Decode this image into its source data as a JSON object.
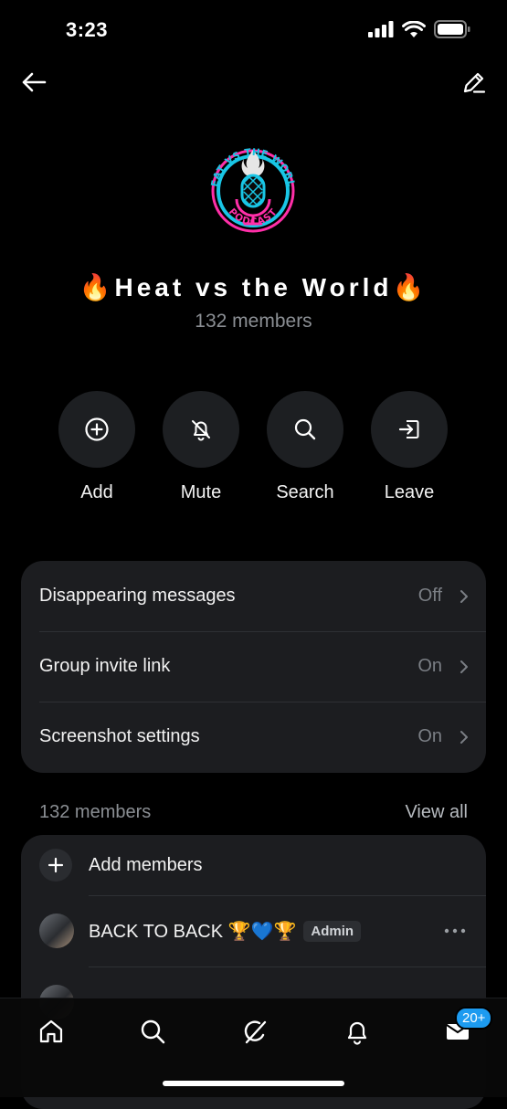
{
  "status": {
    "time": "3:23"
  },
  "group": {
    "name": "🔥Heat vs the World🔥",
    "member_count": "132 members",
    "logo_text_top": "HEAT VS THE WORLD",
    "logo_text_bottom": "PODCAST"
  },
  "actions": [
    {
      "label": "Add",
      "icon": "add-circle-icon"
    },
    {
      "label": "Mute",
      "icon": "bell-off-icon"
    },
    {
      "label": "Search",
      "icon": "search-icon"
    },
    {
      "label": "Leave",
      "icon": "leave-icon"
    }
  ],
  "settings": [
    {
      "title": "Disappearing messages",
      "value": "Off"
    },
    {
      "title": "Group invite link",
      "value": "On"
    },
    {
      "title": "Screenshot settings",
      "value": "On"
    }
  ],
  "members_section": {
    "header": "132 members",
    "view_all": "View all",
    "add_label": "Add members",
    "members": [
      {
        "name": "BACK TO BACK 🏆💙🏆",
        "badge": "Admin"
      }
    ]
  },
  "tabbar": {
    "items": [
      "home-icon",
      "search-icon",
      "grok-icon",
      "bell-icon",
      "mail-icon"
    ],
    "mail_badge": "20+"
  },
  "colors": {
    "background": "#000000",
    "card": "#1c1d20",
    "muted_text": "#8b8f94",
    "accent": "#1d9bf0",
    "logo_cyan": "#19c6e6",
    "logo_pink": "#ff2fa8"
  }
}
